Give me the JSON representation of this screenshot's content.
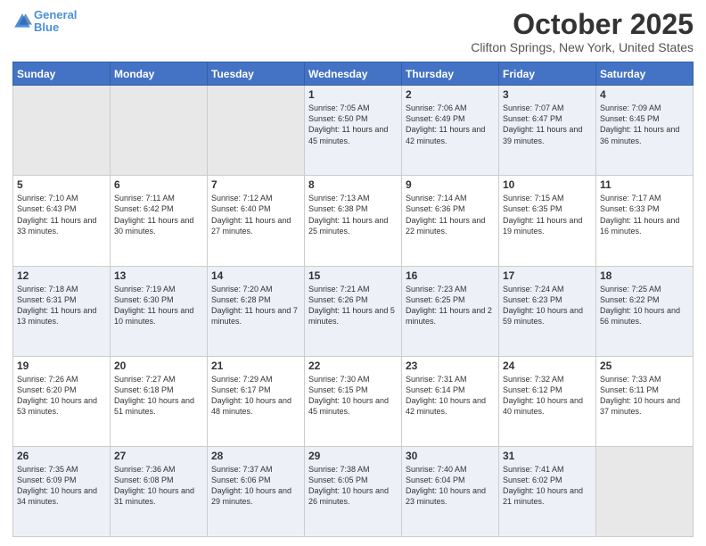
{
  "header": {
    "logo_line1": "General",
    "logo_line2": "Blue",
    "month": "October 2025",
    "location": "Clifton Springs, New York, United States"
  },
  "days_of_week": [
    "Sunday",
    "Monday",
    "Tuesday",
    "Wednesday",
    "Thursday",
    "Friday",
    "Saturday"
  ],
  "weeks": [
    [
      {
        "day": "",
        "sunrise": "",
        "sunset": "",
        "daylight": "",
        "empty": true
      },
      {
        "day": "",
        "sunrise": "",
        "sunset": "",
        "daylight": "",
        "empty": true
      },
      {
        "day": "",
        "sunrise": "",
        "sunset": "",
        "daylight": "",
        "empty": true
      },
      {
        "day": "1",
        "sunrise": "Sunrise: 7:05 AM",
        "sunset": "Sunset: 6:50 PM",
        "daylight": "Daylight: 11 hours and 45 minutes."
      },
      {
        "day": "2",
        "sunrise": "Sunrise: 7:06 AM",
        "sunset": "Sunset: 6:49 PM",
        "daylight": "Daylight: 11 hours and 42 minutes."
      },
      {
        "day": "3",
        "sunrise": "Sunrise: 7:07 AM",
        "sunset": "Sunset: 6:47 PM",
        "daylight": "Daylight: 11 hours and 39 minutes."
      },
      {
        "day": "4",
        "sunrise": "Sunrise: 7:09 AM",
        "sunset": "Sunset: 6:45 PM",
        "daylight": "Daylight: 11 hours and 36 minutes."
      }
    ],
    [
      {
        "day": "5",
        "sunrise": "Sunrise: 7:10 AM",
        "sunset": "Sunset: 6:43 PM",
        "daylight": "Daylight: 11 hours and 33 minutes."
      },
      {
        "day": "6",
        "sunrise": "Sunrise: 7:11 AM",
        "sunset": "Sunset: 6:42 PM",
        "daylight": "Daylight: 11 hours and 30 minutes."
      },
      {
        "day": "7",
        "sunrise": "Sunrise: 7:12 AM",
        "sunset": "Sunset: 6:40 PM",
        "daylight": "Daylight: 11 hours and 27 minutes."
      },
      {
        "day": "8",
        "sunrise": "Sunrise: 7:13 AM",
        "sunset": "Sunset: 6:38 PM",
        "daylight": "Daylight: 11 hours and 25 minutes."
      },
      {
        "day": "9",
        "sunrise": "Sunrise: 7:14 AM",
        "sunset": "Sunset: 6:36 PM",
        "daylight": "Daylight: 11 hours and 22 minutes."
      },
      {
        "day": "10",
        "sunrise": "Sunrise: 7:15 AM",
        "sunset": "Sunset: 6:35 PM",
        "daylight": "Daylight: 11 hours and 19 minutes."
      },
      {
        "day": "11",
        "sunrise": "Sunrise: 7:17 AM",
        "sunset": "Sunset: 6:33 PM",
        "daylight": "Daylight: 11 hours and 16 minutes."
      }
    ],
    [
      {
        "day": "12",
        "sunrise": "Sunrise: 7:18 AM",
        "sunset": "Sunset: 6:31 PM",
        "daylight": "Daylight: 11 hours and 13 minutes."
      },
      {
        "day": "13",
        "sunrise": "Sunrise: 7:19 AM",
        "sunset": "Sunset: 6:30 PM",
        "daylight": "Daylight: 11 hours and 10 minutes."
      },
      {
        "day": "14",
        "sunrise": "Sunrise: 7:20 AM",
        "sunset": "Sunset: 6:28 PM",
        "daylight": "Daylight: 11 hours and 7 minutes."
      },
      {
        "day": "15",
        "sunrise": "Sunrise: 7:21 AM",
        "sunset": "Sunset: 6:26 PM",
        "daylight": "Daylight: 11 hours and 5 minutes."
      },
      {
        "day": "16",
        "sunrise": "Sunrise: 7:23 AM",
        "sunset": "Sunset: 6:25 PM",
        "daylight": "Daylight: 11 hours and 2 minutes."
      },
      {
        "day": "17",
        "sunrise": "Sunrise: 7:24 AM",
        "sunset": "Sunset: 6:23 PM",
        "daylight": "Daylight: 10 hours and 59 minutes."
      },
      {
        "day": "18",
        "sunrise": "Sunrise: 7:25 AM",
        "sunset": "Sunset: 6:22 PM",
        "daylight": "Daylight: 10 hours and 56 minutes."
      }
    ],
    [
      {
        "day": "19",
        "sunrise": "Sunrise: 7:26 AM",
        "sunset": "Sunset: 6:20 PM",
        "daylight": "Daylight: 10 hours and 53 minutes."
      },
      {
        "day": "20",
        "sunrise": "Sunrise: 7:27 AM",
        "sunset": "Sunset: 6:18 PM",
        "daylight": "Daylight: 10 hours and 51 minutes."
      },
      {
        "day": "21",
        "sunrise": "Sunrise: 7:29 AM",
        "sunset": "Sunset: 6:17 PM",
        "daylight": "Daylight: 10 hours and 48 minutes."
      },
      {
        "day": "22",
        "sunrise": "Sunrise: 7:30 AM",
        "sunset": "Sunset: 6:15 PM",
        "daylight": "Daylight: 10 hours and 45 minutes."
      },
      {
        "day": "23",
        "sunrise": "Sunrise: 7:31 AM",
        "sunset": "Sunset: 6:14 PM",
        "daylight": "Daylight: 10 hours and 42 minutes."
      },
      {
        "day": "24",
        "sunrise": "Sunrise: 7:32 AM",
        "sunset": "Sunset: 6:12 PM",
        "daylight": "Daylight: 10 hours and 40 minutes."
      },
      {
        "day": "25",
        "sunrise": "Sunrise: 7:33 AM",
        "sunset": "Sunset: 6:11 PM",
        "daylight": "Daylight: 10 hours and 37 minutes."
      }
    ],
    [
      {
        "day": "26",
        "sunrise": "Sunrise: 7:35 AM",
        "sunset": "Sunset: 6:09 PM",
        "daylight": "Daylight: 10 hours and 34 minutes."
      },
      {
        "day": "27",
        "sunrise": "Sunrise: 7:36 AM",
        "sunset": "Sunset: 6:08 PM",
        "daylight": "Daylight: 10 hours and 31 minutes."
      },
      {
        "day": "28",
        "sunrise": "Sunrise: 7:37 AM",
        "sunset": "Sunset: 6:06 PM",
        "daylight": "Daylight: 10 hours and 29 minutes."
      },
      {
        "day": "29",
        "sunrise": "Sunrise: 7:38 AM",
        "sunset": "Sunset: 6:05 PM",
        "daylight": "Daylight: 10 hours and 26 minutes."
      },
      {
        "day": "30",
        "sunrise": "Sunrise: 7:40 AM",
        "sunset": "Sunset: 6:04 PM",
        "daylight": "Daylight: 10 hours and 23 minutes."
      },
      {
        "day": "31",
        "sunrise": "Sunrise: 7:41 AM",
        "sunset": "Sunset: 6:02 PM",
        "daylight": "Daylight: 10 hours and 21 minutes."
      },
      {
        "day": "",
        "sunrise": "",
        "sunset": "",
        "daylight": "",
        "empty": true
      }
    ]
  ]
}
